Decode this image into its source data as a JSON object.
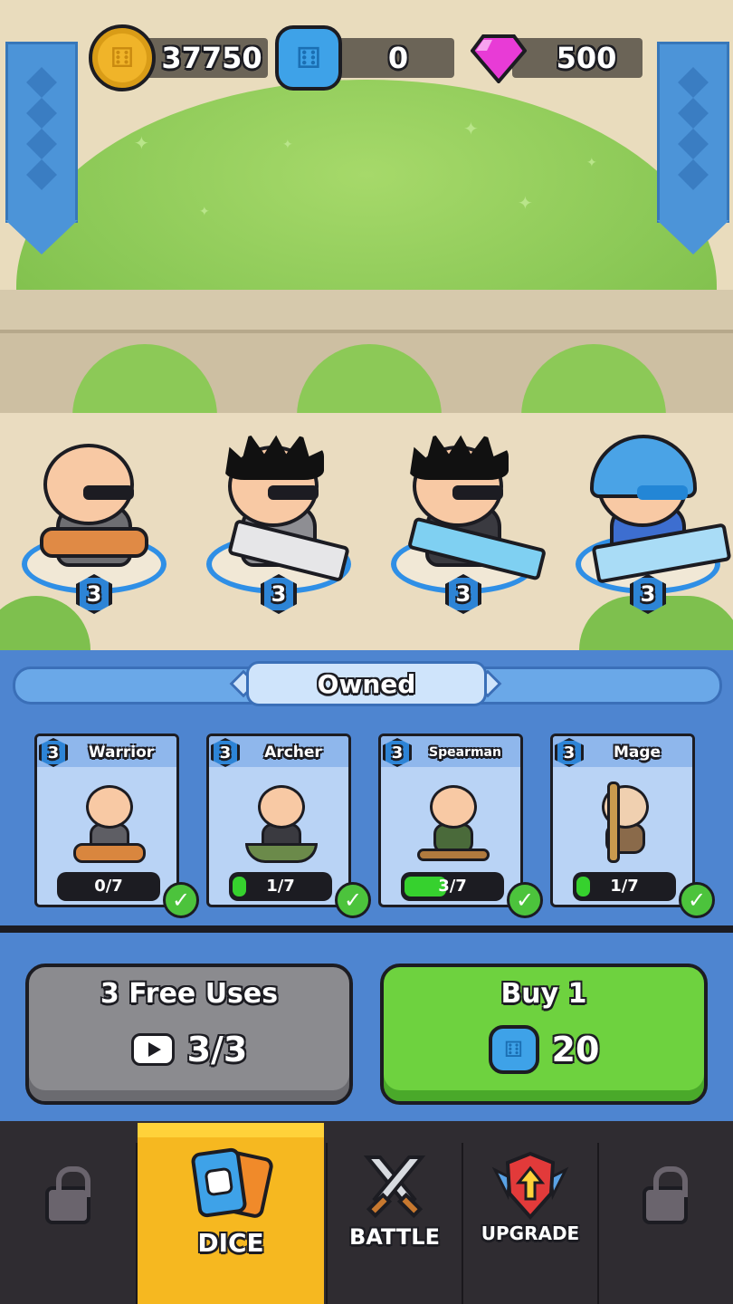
{
  "currency": {
    "coins": "37750",
    "dice": "0",
    "gems": "500"
  },
  "heroes": [
    {
      "level": "3"
    },
    {
      "level": "3"
    },
    {
      "level": "3"
    },
    {
      "level": "3"
    }
  ],
  "owned": {
    "title": "Owned",
    "cards": [
      {
        "name": "Warrior",
        "level": "3",
        "progress_text": "0/7",
        "progress": 0.0
      },
      {
        "name": "Archer",
        "level": "3",
        "progress_text": "1/7",
        "progress": 0.14
      },
      {
        "name": "Spearman",
        "level": "3",
        "progress_text": "3/7",
        "progress": 0.43
      },
      {
        "name": "Mage",
        "level": "3",
        "progress_text": "1/7",
        "progress": 0.14
      }
    ]
  },
  "actions": {
    "free": {
      "title": "3 Free Uses",
      "count": "3/3"
    },
    "buy": {
      "title": "Buy 1",
      "price": "20"
    }
  },
  "nav": {
    "dice": "DICE",
    "battle": "BATTLE",
    "upgrade": "UPGRADE"
  },
  "colors": {
    "accent_blue": "#4e85d0",
    "progress_green": "#36d12e",
    "active_tab": "#f6b820",
    "buy_green": "#6ed23f"
  },
  "icons": [
    "coin-icon",
    "dice-icon",
    "gem-icon",
    "video-icon",
    "lock-icon",
    "swords-icon",
    "upgrade-shield-icon",
    "check-icon"
  ]
}
